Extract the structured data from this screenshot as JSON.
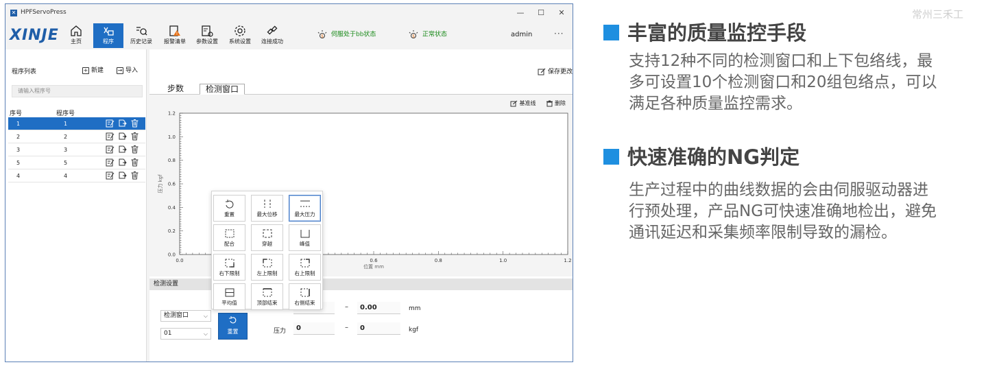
{
  "window": {
    "title": "HPFServoPress",
    "controls": [
      "—",
      "☐",
      "✕"
    ]
  },
  "logo": "XINJE",
  "toolbar": {
    "items": [
      {
        "id": "home",
        "label": "主页"
      },
      {
        "id": "program",
        "label": "程序"
      },
      {
        "id": "history",
        "label": "历史记录"
      },
      {
        "id": "alarm",
        "label": "报警清单"
      },
      {
        "id": "params",
        "label": "参数设置"
      },
      {
        "id": "system",
        "label": "系统设置"
      },
      {
        "id": "connection",
        "label": "连接成功"
      }
    ],
    "status1": "伺服处于bb状态",
    "status2": "正常状态",
    "user": "admin",
    "more": "···"
  },
  "program_list": {
    "title": "程序列表",
    "new_label": "新建",
    "import_label": "导入",
    "search_placeholder": "请输入程序号",
    "col_index": "序号",
    "col_program": "程序号",
    "rows": [
      {
        "index": "1",
        "program": "1",
        "selected": true
      },
      {
        "index": "2",
        "program": "2",
        "selected": false
      },
      {
        "index": "3",
        "program": "3",
        "selected": false
      },
      {
        "index": "5",
        "program": "5",
        "selected": false
      },
      {
        "index": "4",
        "program": "4",
        "selected": false
      }
    ]
  },
  "main": {
    "save_label": "保存更改",
    "tabs": [
      {
        "label": "步数",
        "active": false
      },
      {
        "label": "检测窗口",
        "active": true
      }
    ],
    "baseline_label": "基准线",
    "delete_label": "删除",
    "detect_settings_label": "检测设置",
    "window_select_value": "检测窗口",
    "index_select_value": "01",
    "reset_button_label": "重置",
    "pressure_label": "压力",
    "pos_from": "",
    "pos_to": "0.00",
    "pos_unit": "mm",
    "press_from": "0",
    "press_to": "0",
    "press_unit": "kgf",
    "dash": "–"
  },
  "popup": {
    "buttons": [
      {
        "id": "reset",
        "label": "重置",
        "highlight": false
      },
      {
        "id": "max-displacement",
        "label": "最大位移",
        "highlight": false
      },
      {
        "id": "max-pressure",
        "label": "最大压力",
        "highlight": true
      },
      {
        "id": "fit",
        "label": "配合",
        "highlight": false
      },
      {
        "id": "cross",
        "label": "穿越",
        "highlight": false
      },
      {
        "id": "peak",
        "label": "峰值",
        "highlight": false
      },
      {
        "id": "right-lower-limit",
        "label": "右下限制",
        "highlight": false
      },
      {
        "id": "left-upper-limit",
        "label": "左上限制",
        "highlight": false
      },
      {
        "id": "right-upper-limit",
        "label": "右上限制",
        "highlight": false
      },
      {
        "id": "average",
        "label": "平均值",
        "highlight": false
      },
      {
        "id": "top-end",
        "label": "顶部结束",
        "highlight": false
      },
      {
        "id": "right-end",
        "label": "右侧结束",
        "highlight": false
      }
    ]
  },
  "chart_data": {
    "type": "line",
    "title": "",
    "xlabel": "位置 mm",
    "ylabel": "压力 kgf",
    "xlim": [
      0,
      1.2
    ],
    "ylim": [
      0,
      1.2
    ],
    "xticks": [
      "0.0",
      "0.2",
      "0.4",
      "0.6",
      "0.8",
      "1.0",
      "1.2"
    ],
    "yticks": [
      "0.0",
      "0.2",
      "0.4",
      "0.6",
      "0.8",
      "1.0",
      "1.2"
    ],
    "series": []
  },
  "marketing": {
    "watermark": "常州三禾工",
    "feature1_title": "丰富的质量监控手段",
    "feature1_lines": [
      "支持12种不同的检测窗口和上下包络线，最",
      "多可设置10个检测窗口和20组包络点，可以",
      "满足各种质量监控需求。"
    ],
    "feature2_title": "快速准确的NG判定",
    "feature2_lines": [
      "生产过程中的曲线数据的会由伺服驱动器进",
      "行预处理，产品NG可快速准确地检出，避免",
      "通讯延迟和采集频率限制导致的漏检。"
    ]
  },
  "colors": {
    "accent": "#1f6ec4",
    "status_ok": "#1a8a1a",
    "bullet": "#1e8fe0"
  }
}
